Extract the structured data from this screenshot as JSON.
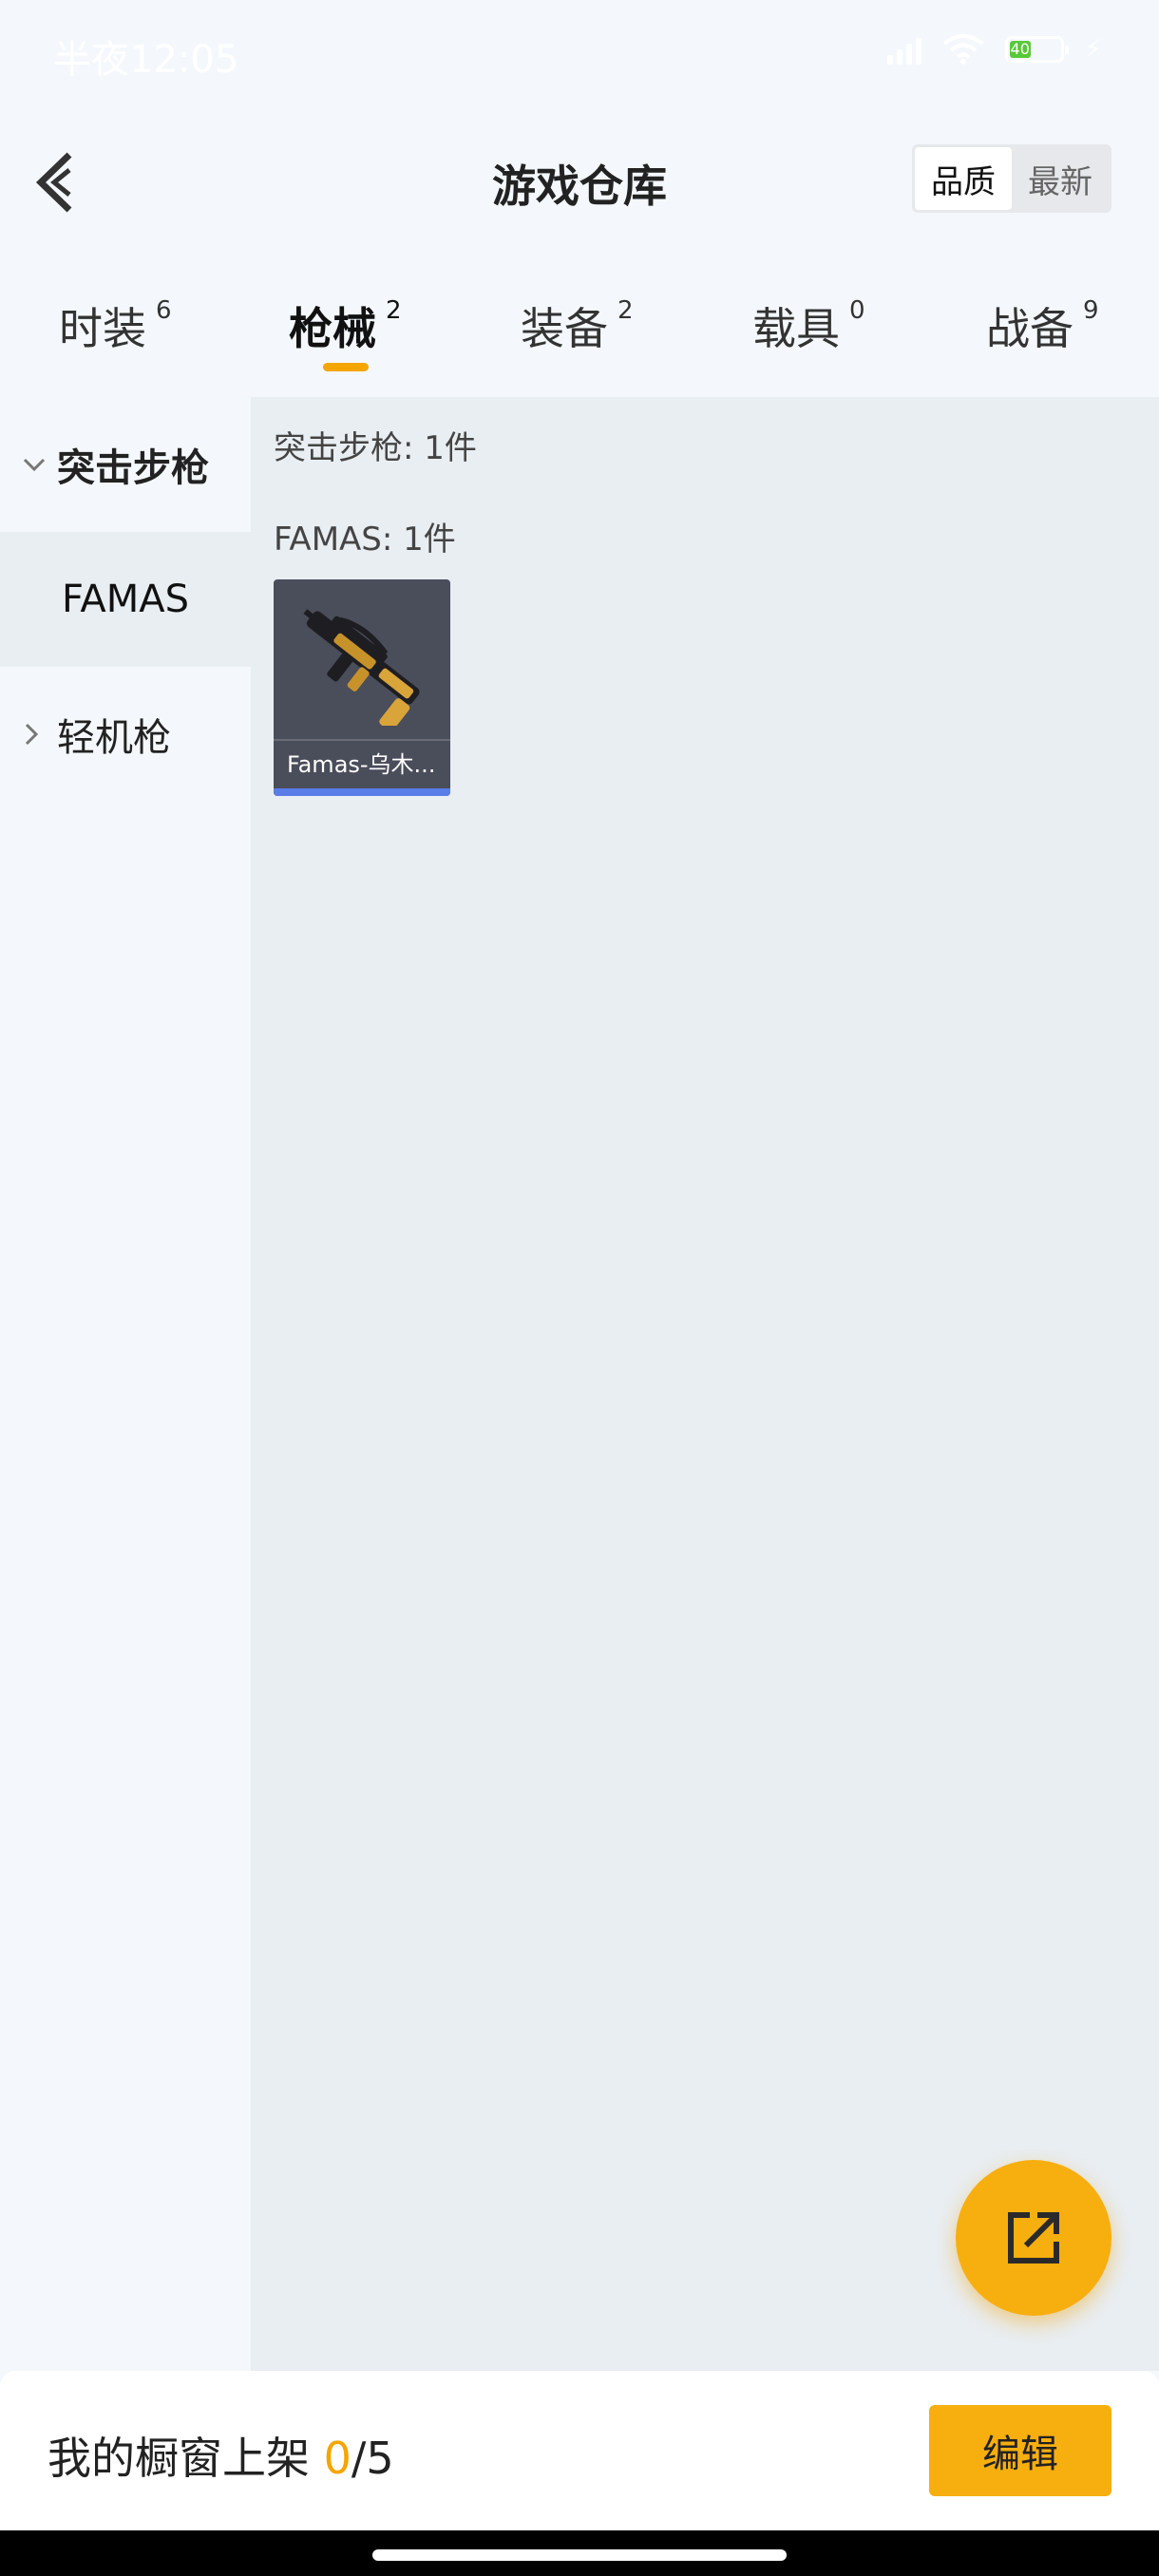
{
  "status_bar": {
    "time": "半夜12:05",
    "battery_level": "40",
    "battery_fraction": 0.4
  },
  "header": {
    "title": "游戏仓库",
    "back_icon": "back-arrow-icon",
    "sort_options": [
      {
        "label": "品质",
        "active": true
      },
      {
        "label": "最新",
        "active": false
      }
    ]
  },
  "tabs": [
    {
      "label": "时装",
      "count": "6",
      "active": false
    },
    {
      "label": "枪械",
      "count": "2",
      "active": true
    },
    {
      "label": "装备",
      "count": "2",
      "active": false
    },
    {
      "label": "载具",
      "count": "0",
      "active": false
    },
    {
      "label": "战备",
      "count": "9",
      "active": false
    }
  ],
  "sidebar": {
    "groups": [
      {
        "label": "突击步枪",
        "expanded": true,
        "children": [
          {
            "label": "FAMAS",
            "selected": true
          }
        ]
      },
      {
        "label": "轻机枪",
        "expanded": false,
        "children": []
      }
    ]
  },
  "content": {
    "category_heading": "突击步枪: 1件",
    "subcategory_heading": "FAMAS: 1件",
    "items": [
      {
        "name": "Famas-乌木...",
        "icon": "rifle-icon",
        "quality_color": "#5b7de8"
      }
    ]
  },
  "fab": {
    "icon": "share-external-icon"
  },
  "bottom_bar": {
    "label": "我的橱窗上架",
    "current": "0",
    "separator": "/",
    "max": "5",
    "edit_label": "编辑"
  },
  "colors": {
    "accent": "#f7ae0f",
    "tab_indicator": "#f5a500",
    "panel_bg": "#e9eef2",
    "card_bg": "#4a4d5a"
  }
}
